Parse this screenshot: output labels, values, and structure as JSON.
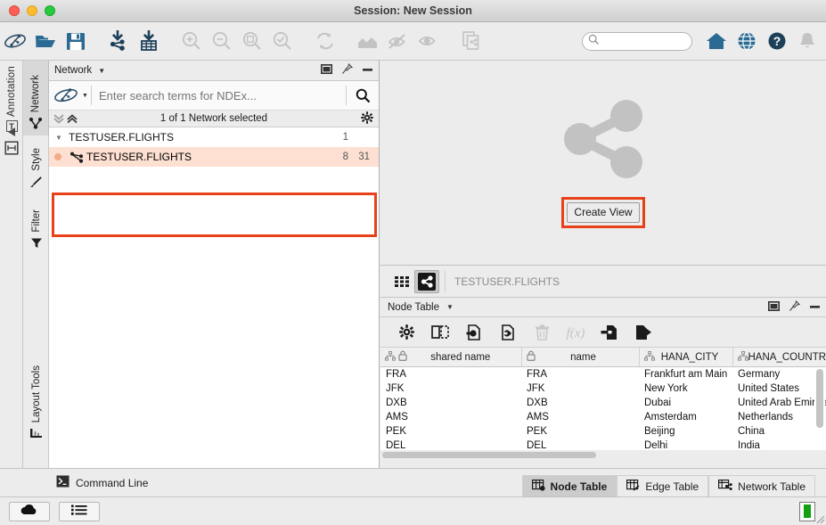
{
  "window": {
    "title": "Session: New Session",
    "traffic_lights": [
      "close",
      "minimize",
      "maximize"
    ]
  },
  "toolbar": {
    "items": [
      {
        "name": "ndex-logo-icon",
        "label": "NDEx"
      },
      {
        "name": "open-folder-icon",
        "label": "Open"
      },
      {
        "name": "save-icon",
        "label": "Save"
      },
      {
        "name": "import-network-icon",
        "label": "Import Network"
      },
      {
        "name": "import-table-icon",
        "label": "Import Table"
      },
      {
        "name": "zoom-in-icon",
        "label": "Zoom In"
      },
      {
        "name": "zoom-out-icon",
        "label": "Zoom Out"
      },
      {
        "name": "zoom-fit-icon",
        "label": "Fit Network"
      },
      {
        "name": "zoom-selected-icon",
        "label": "Fit Selected"
      },
      {
        "name": "refresh-icon",
        "label": "Refresh"
      },
      {
        "name": "hide-selected-icon",
        "label": "Hide Selected"
      },
      {
        "name": "hide-unselected-icon",
        "label": "Hide Unselected"
      },
      {
        "name": "show-all-icon",
        "label": "Show All"
      },
      {
        "name": "clone-network-icon",
        "label": "New Network From Selection"
      },
      {
        "name": "home-icon",
        "label": "Home"
      },
      {
        "name": "web-icon",
        "label": "Web"
      },
      {
        "name": "help-icon",
        "label": "Help"
      },
      {
        "name": "bell-icon",
        "label": "Notifications"
      }
    ],
    "search_placeholder": ""
  },
  "left_rail": {
    "annotation_label": "Annotation",
    "collapse_label": "Collapse",
    "panel_label": "Toggle Panel"
  },
  "vtabs": [
    {
      "label": "Network",
      "icon": "network-icon",
      "active": true
    },
    {
      "label": "Style",
      "icon": "brush-icon",
      "active": false
    },
    {
      "label": "Filter",
      "icon": "funnel-icon",
      "active": false
    },
    {
      "label": "Layout Tools",
      "icon": "layout-icon",
      "active": false
    }
  ],
  "network_panel": {
    "header_title": "Network",
    "header_buttons": [
      "float-window-icon",
      "pin-icon",
      "minimize-icon"
    ],
    "ndex_search": {
      "placeholder": "Enter search terms for NDEx...",
      "value": "",
      "logo": "ndex-logo-icon",
      "search_icon": "search-icon"
    },
    "selection_bar": {
      "text": "1 of 1 Network selected",
      "collapse_all_icon": "chevron-double-down-icon",
      "expand_all_icon": "chevron-double-up-icon",
      "settings_icon": "gear-icon"
    },
    "tree": [
      {
        "label": "TESTUSER.FLIGHTS",
        "node_count": "1",
        "edge_count": "",
        "type": "collection",
        "expanded": true,
        "selected": false
      },
      {
        "label": "TESTUSER.FLIGHTS",
        "node_count": "8",
        "edge_count": "31",
        "type": "network",
        "expanded": false,
        "selected": true
      }
    ]
  },
  "view_area": {
    "placeholder_icon": "network-share-icon",
    "create_view_label": "Create View",
    "highlight_color": "#e8411a"
  },
  "table_panel": {
    "view_switch": {
      "grid_icon": "grid-view-icon",
      "network_icon": "network-view-icon",
      "active": "network-view-icon",
      "network_name": "TESTUSER.FLIGHTS"
    },
    "header": {
      "title": "Node Table",
      "buttons": [
        "float-window-icon",
        "pin-icon",
        "minimize-icon"
      ]
    },
    "toolbar_buttons": [
      {
        "name": "settings-gear-icon",
        "enabled": true
      },
      {
        "name": "show-columns-icon",
        "enabled": true
      },
      {
        "name": "import-column-icon",
        "enabled": true
      },
      {
        "name": "export-column-icon",
        "enabled": true
      },
      {
        "name": "delete-column-icon",
        "enabled": false
      },
      {
        "name": "function-builder-icon",
        "enabled": false
      },
      {
        "name": "import-table-file-icon",
        "enabled": true
      },
      {
        "name": "export-table-file-icon",
        "enabled": true
      }
    ],
    "columns": [
      {
        "label": "shared name",
        "icons": [
          "network-icon",
          "lock-icon"
        ]
      },
      {
        "label": "name",
        "icons": [
          "lock-icon"
        ]
      },
      {
        "label": "HANA_CITY",
        "icons": [
          "network-icon"
        ]
      },
      {
        "label": "HANA_COUNTR",
        "icons": [
          "network-icon"
        ]
      }
    ],
    "rows": [
      [
        "FRA",
        "FRA",
        "Frankfurt am Main",
        "Germany"
      ],
      [
        "JFK",
        "JFK",
        "New York",
        "United States"
      ],
      [
        "DXB",
        "DXB",
        "Dubai",
        "United Arab Emirates"
      ],
      [
        "AMS",
        "AMS",
        "Amsterdam",
        "Netherlands"
      ],
      [
        "PEK",
        "PEK",
        "Beijing",
        "China"
      ],
      [
        "DEL",
        "DEL",
        "Delhi",
        "India"
      ]
    ]
  },
  "command_line": {
    "label": "Command Line",
    "icon": "terminal-icon"
  },
  "bottom_tabs": [
    {
      "label": "Node Table",
      "icon": "node-table-icon",
      "active": true
    },
    {
      "label": "Edge Table",
      "icon": "edge-table-icon",
      "active": false
    },
    {
      "label": "Network Table",
      "icon": "network-table-icon",
      "active": false
    }
  ],
  "status_bar": {
    "cloud_icon": "cloud-icon",
    "list_icon": "list-icon",
    "memory_icon": "memory-meter-icon",
    "memory_color": "#10a010"
  }
}
